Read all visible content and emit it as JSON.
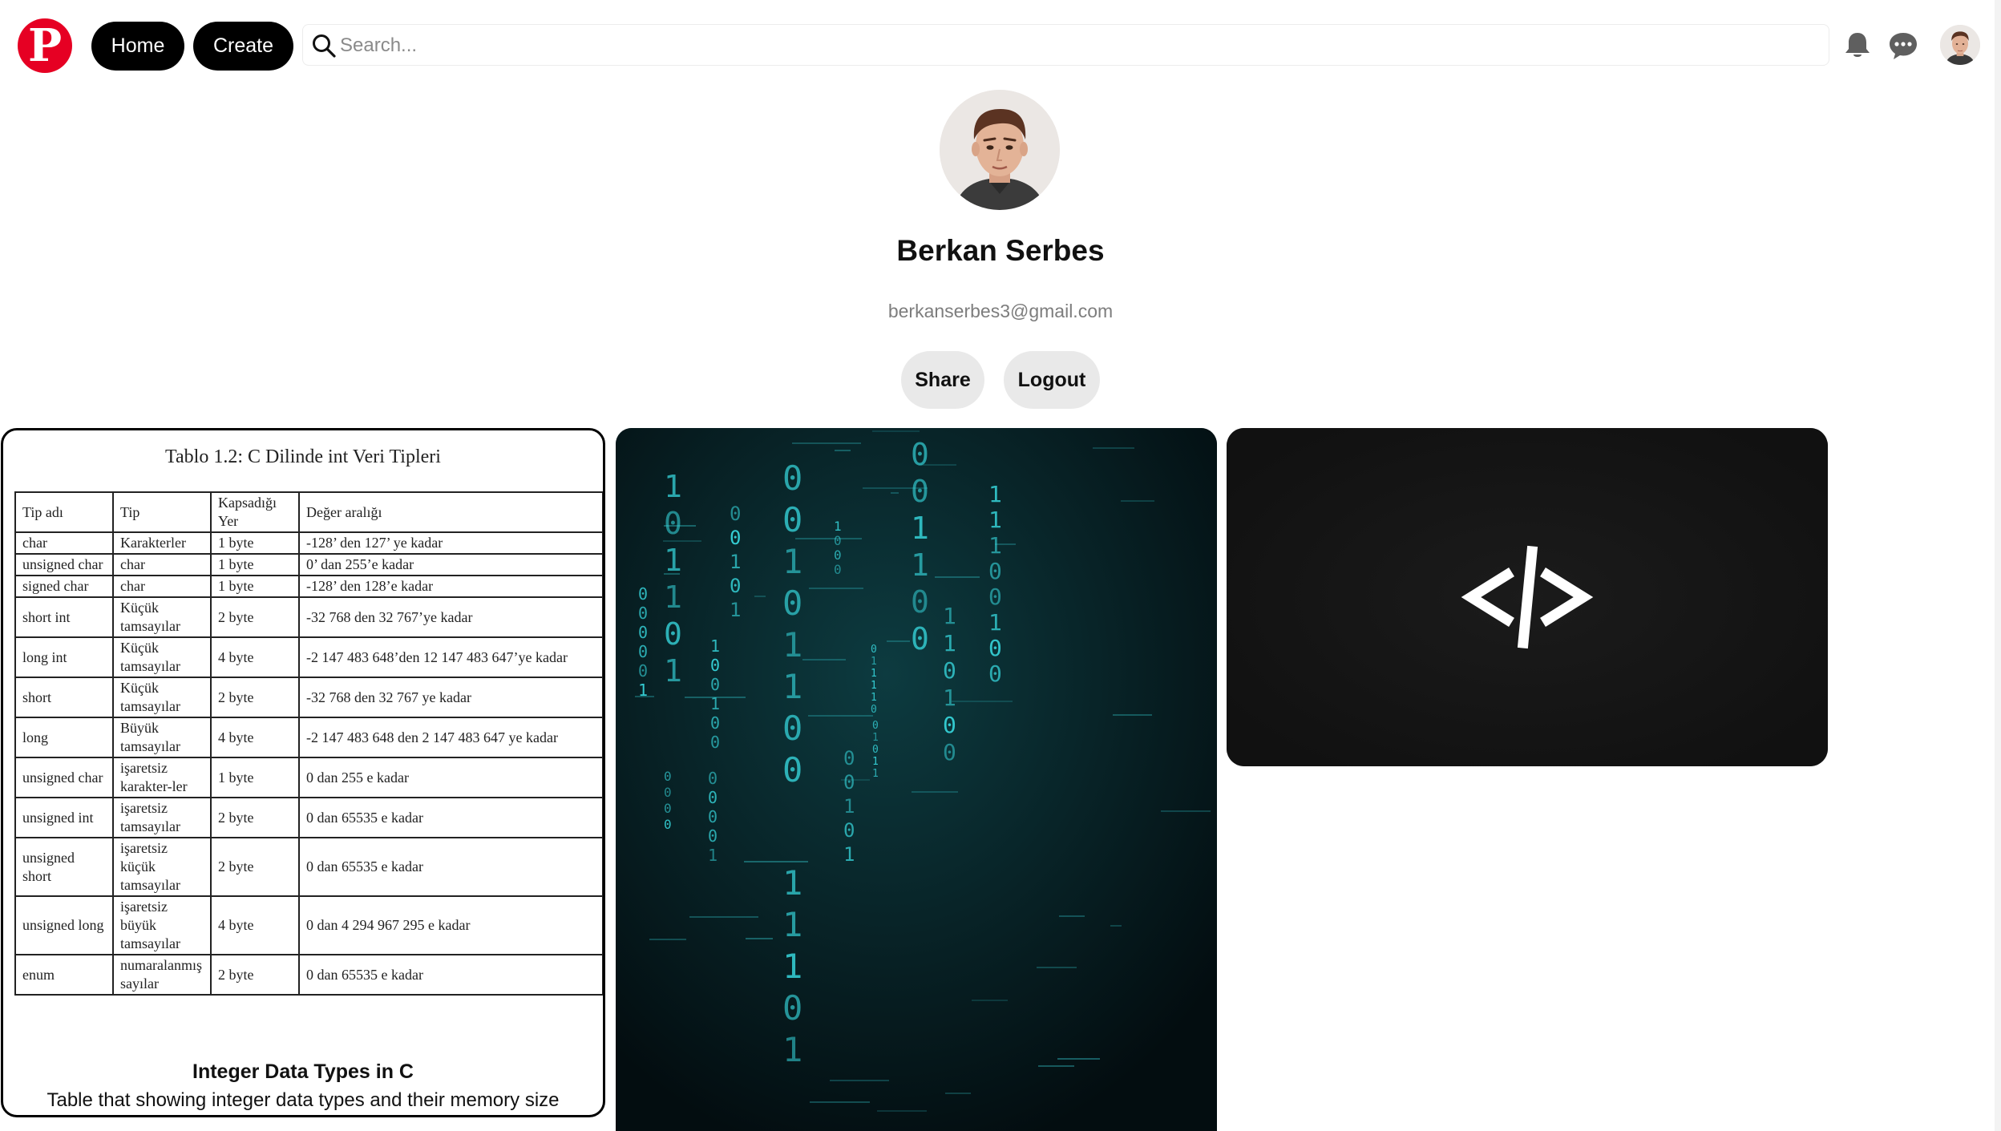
{
  "nav": {
    "logo_letter": "P",
    "home_label": "Home",
    "create_label": "Create",
    "search_placeholder": "Search..."
  },
  "icons": {
    "logo": "pinterest-logo",
    "search": "search-icon",
    "notifications": "bell-icon",
    "messages": "chat-bubble-icon"
  },
  "colors": {
    "brand": "#e60023",
    "pill_dark": "#000000",
    "button_light": "#e9e9e9",
    "matrix_glyph": "#35d0d6",
    "code_card_bg": "#141414"
  },
  "profile": {
    "name": "Berkan Serbes",
    "email": "berkanserbes3@gmail.com",
    "share_label": "Share",
    "logout_label": "Logout"
  },
  "pins": [
    {
      "title": "Integer Data Types in C",
      "description": "Table that showing integer data types and their memory size",
      "table": {
        "caption": "Tablo 1.2: C Dilinde int Veri Tipleri",
        "headers": [
          "Tip adı",
          "Tip",
          "Kapsadığı Yer",
          "Değer aralığı"
        ],
        "rows": [
          [
            "char",
            "Karakterler",
            "1 byte",
            "-128’ den 127’ ye kadar"
          ],
          [
            "unsigned char",
            "char",
            "1 byte",
            "0’ dan 255’e kadar"
          ],
          [
            "signed char",
            "char",
            "1 byte",
            "-128’ den 128’e kadar"
          ],
          [
            "short int",
            "Küçük tamsayılar",
            "2 byte",
            "-32 768 den 32 767’ye kadar"
          ],
          [
            "long int",
            "Küçük tamsayılar",
            "4 byte",
            "-2 147 483 648’den 12 147 483 647’ye kadar"
          ],
          [
            "short",
            "Küçük tamsayılar",
            "2 byte",
            "-32 768 den 32 767 ye kadar"
          ],
          [
            "long",
            "Büyük tamsayılar",
            "4 byte",
            "-2 147 483 648 den 2 147 483 647 ye kadar"
          ],
          [
            "unsigned char",
            "işaretsiz karakter-ler",
            "1 byte",
            "0 dan 255 e kadar"
          ],
          [
            "unsigned int",
            "işaretsiz tamsayılar",
            "2 byte",
            "0 dan 65535 e kadar"
          ],
          [
            "unsigned short",
            "işaretsiz küçük tamsayılar",
            "2 byte",
            "0 dan 65535 e kadar"
          ],
          [
            "unsigned long",
            "işaretsiz büyük tamsayılar",
            "4 byte",
            "0 dan 4 294 967 295 e kadar"
          ],
          [
            "enum",
            "numaralanmış sayılar",
            "2 byte",
            "0 dan 65535 e kadar"
          ]
        ]
      }
    },
    {
      "image": "binary-code-matrix"
    },
    {
      "image": "code-tag-symbol",
      "symbol": "</>"
    }
  ]
}
